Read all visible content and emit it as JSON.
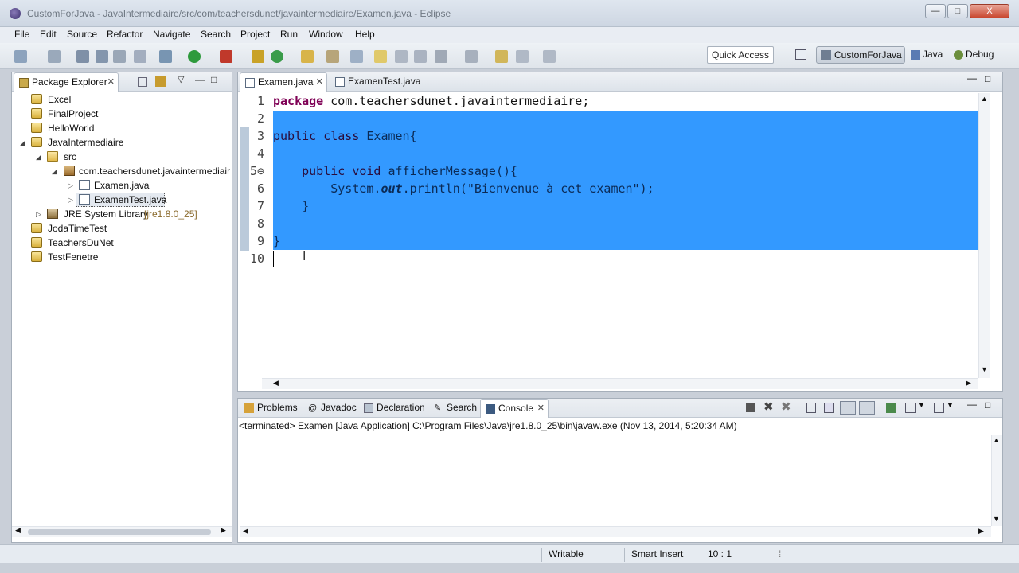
{
  "window": {
    "title": "CustomForJava - JavaIntermediaire/src/com/teachersdunet/javaintermediaire/Examen.java - Eclipse",
    "buttons": {
      "minimize": "—",
      "maximize": "□",
      "close": "X"
    }
  },
  "menubar": [
    "File",
    "Edit",
    "Source",
    "Refactor",
    "Navigate",
    "Search",
    "Project",
    "Run",
    "Window",
    "Help"
  ],
  "toolbar": {
    "quick_access": "Quick Access",
    "perspectives": [
      "CustomForJava",
      "Java",
      "Debug"
    ]
  },
  "package_explorer": {
    "title": "Package Explorer",
    "tree": [
      {
        "label": "Excel",
        "type": "project",
        "expanded": false
      },
      {
        "label": "FinalProject",
        "type": "project",
        "expanded": false
      },
      {
        "label": "HelloWorld",
        "type": "project",
        "expanded": false
      },
      {
        "label": "JavaIntermediaire",
        "type": "project",
        "expanded": true
      },
      {
        "label": "src",
        "type": "folder",
        "expanded": true
      },
      {
        "label": "com.teachersdunet.javaintermediair",
        "type": "package",
        "expanded": true
      },
      {
        "label": "Examen.java",
        "type": "java",
        "expanded": false
      },
      {
        "label": "ExamenTest.java",
        "type": "java",
        "expanded": false,
        "selected": true
      },
      {
        "label": "JRE System Library",
        "suffix": "[jre1.8.0_25]",
        "type": "library",
        "expanded": false
      },
      {
        "label": "JodaTimeTest",
        "type": "project",
        "expanded": false
      },
      {
        "label": "TeachersDuNet",
        "type": "project",
        "expanded": false
      },
      {
        "label": "TestFenetre",
        "type": "project",
        "expanded": false
      }
    ]
  },
  "editor": {
    "tabs": [
      {
        "label": "Examen.java",
        "active": true
      },
      {
        "label": "ExamenTest.java",
        "active": false
      }
    ],
    "lines": [
      {
        "n": "1",
        "tokens": [
          [
            "kw",
            "package"
          ],
          [
            "tx",
            " com.teachersdunet.javaintermediaire;"
          ]
        ]
      },
      {
        "n": "2",
        "tokens": []
      },
      {
        "n": "3",
        "tokens": [
          [
            "kw",
            "public"
          ],
          [
            "tx",
            " "
          ],
          [
            "kw",
            "class"
          ],
          [
            "tx",
            " Examen{"
          ]
        ]
      },
      {
        "n": "4",
        "tokens": []
      },
      {
        "n": "5⊖",
        "tokens": [
          [
            "tx",
            "    "
          ],
          [
            "kw",
            "public"
          ],
          [
            "tx",
            " "
          ],
          [
            "kw",
            "void"
          ],
          [
            "tx",
            " afficherMessage(){"
          ]
        ]
      },
      {
        "n": "6",
        "tokens": [
          [
            "tx",
            "        System."
          ],
          [
            "it",
            "out"
          ],
          [
            "tx",
            ".println(\"Bienvenue à cet examen\");"
          ]
        ]
      },
      {
        "n": "7",
        "tokens": [
          [
            "tx",
            "    }"
          ]
        ]
      },
      {
        "n": "8",
        "tokens": []
      },
      {
        "n": "9",
        "tokens": [
          [
            "tx",
            "}"
          ]
        ]
      },
      {
        "n": "10",
        "tokens": []
      }
    ],
    "selected_lines": [
      3,
      4,
      5,
      6,
      7,
      8,
      9
    ]
  },
  "bottom_panel": {
    "tabs": [
      "Problems",
      "Javadoc",
      "Declaration",
      "Search",
      "Console"
    ],
    "active_tab": "Console",
    "console_text": "<terminated> Examen [Java Application] C:\\Program Files\\Java\\jre1.8.0_25\\bin\\javaw.exe (Nov 13, 2014, 5:20:34 AM)"
  },
  "statusbar": {
    "writable": "Writable",
    "insert_mode": "Smart Insert",
    "position": "10 : 1"
  },
  "colors": {
    "selection": "#3399ff",
    "keyword": "#7f0055"
  }
}
